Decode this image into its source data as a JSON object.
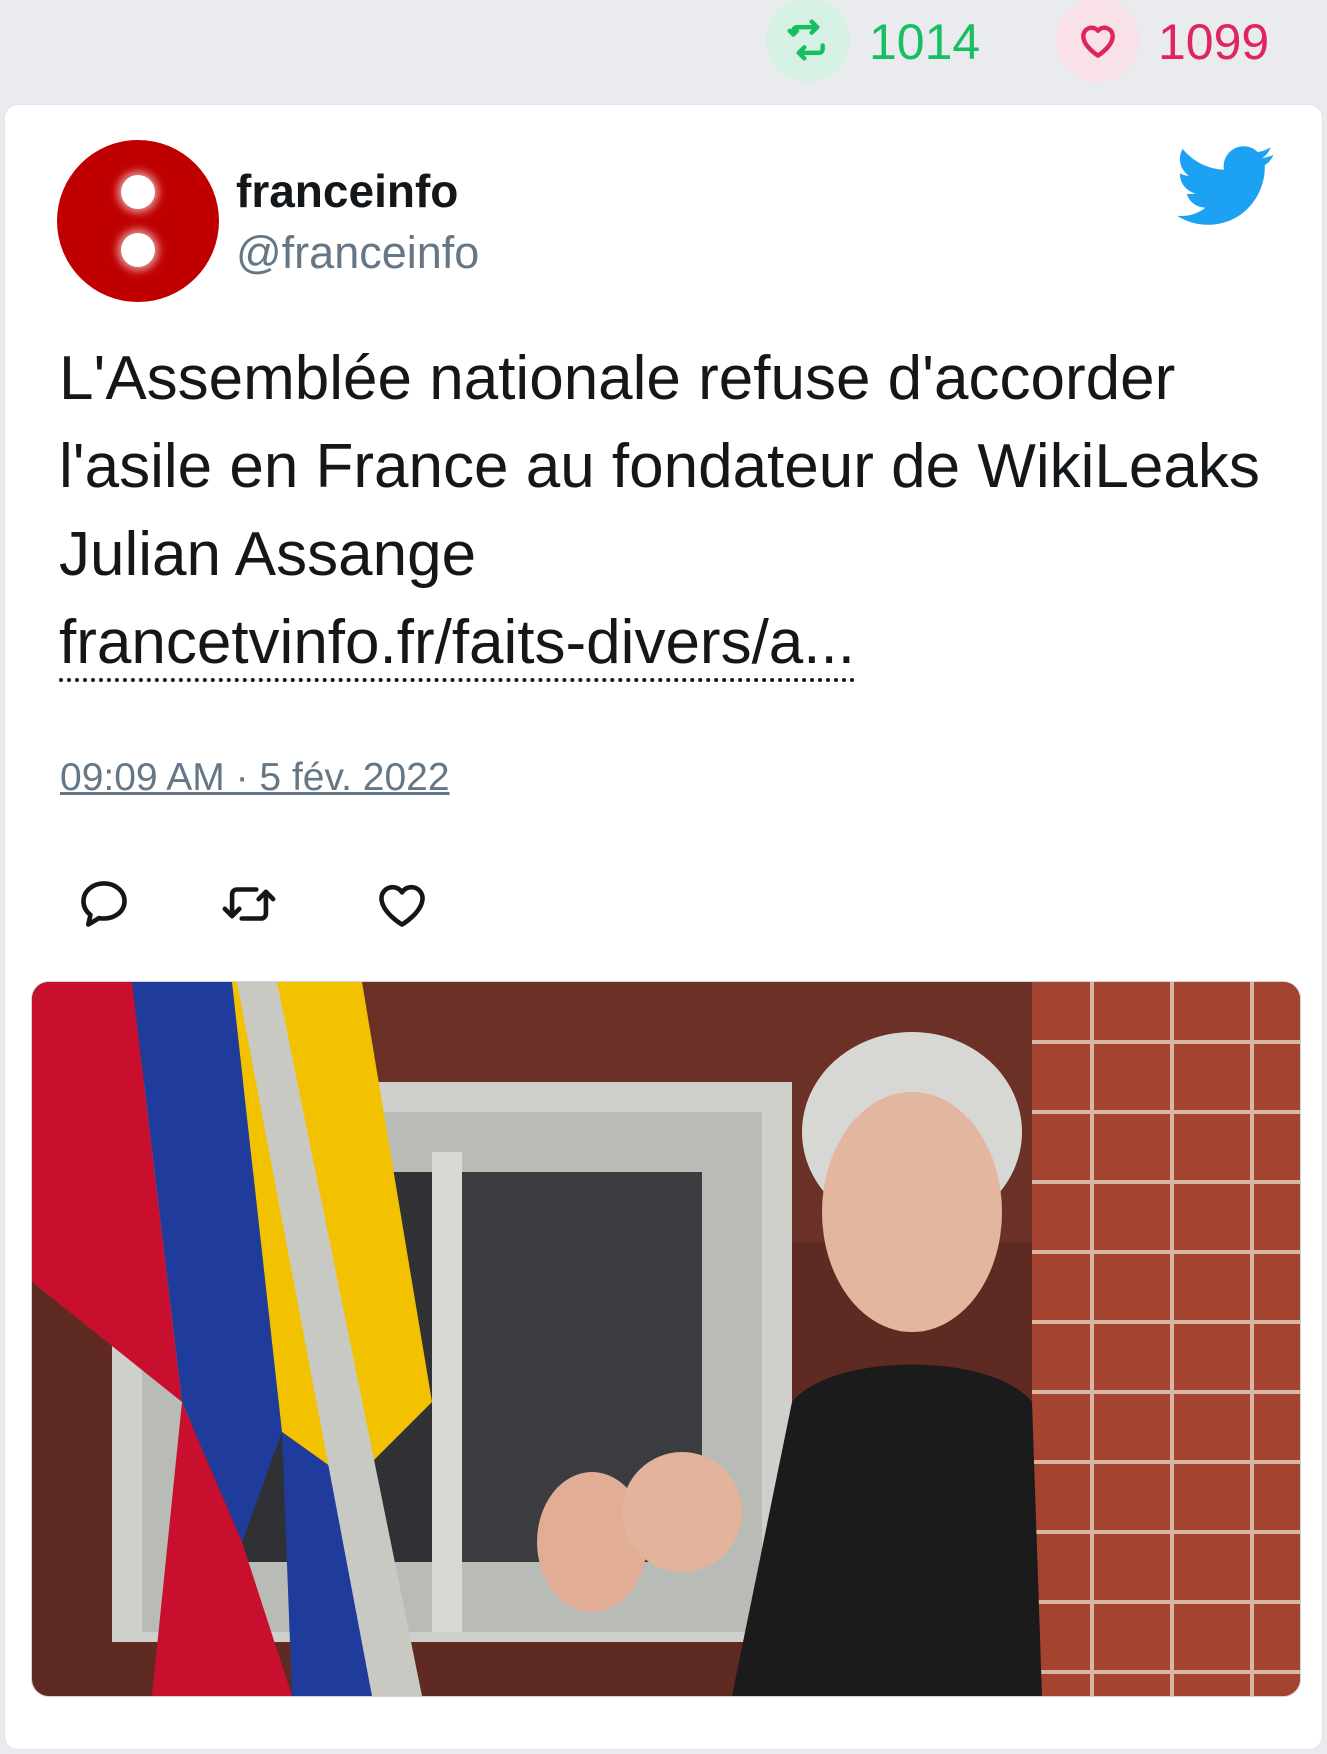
{
  "stats": {
    "retweet_icon": "retweet-icon",
    "retweet_count": "1014",
    "retweet_color": "#17bf63",
    "like_icon": "heart-icon",
    "like_count": "1099",
    "like_color": "#e0245e"
  },
  "tweet": {
    "author": {
      "display_name": "franceinfo",
      "handle": "@franceinfo",
      "avatar_icon": "franceinfo-logo",
      "avatar_color": "#c00000"
    },
    "platform_icon": "twitter-bird-icon",
    "platform_color": "#1da1f2",
    "text": "L'Assemblée nationale refuse d'accorder l'asile en France au fondateur de WikiLeaks Julian Assange",
    "link_text": "francetvinfo.fr/faits-divers/a...",
    "timestamp": "09:09 AM · 5 fév. 2022",
    "actions": [
      "reply-icon",
      "retweet-icon",
      "heart-icon"
    ],
    "media_icon": "photo-image"
  }
}
